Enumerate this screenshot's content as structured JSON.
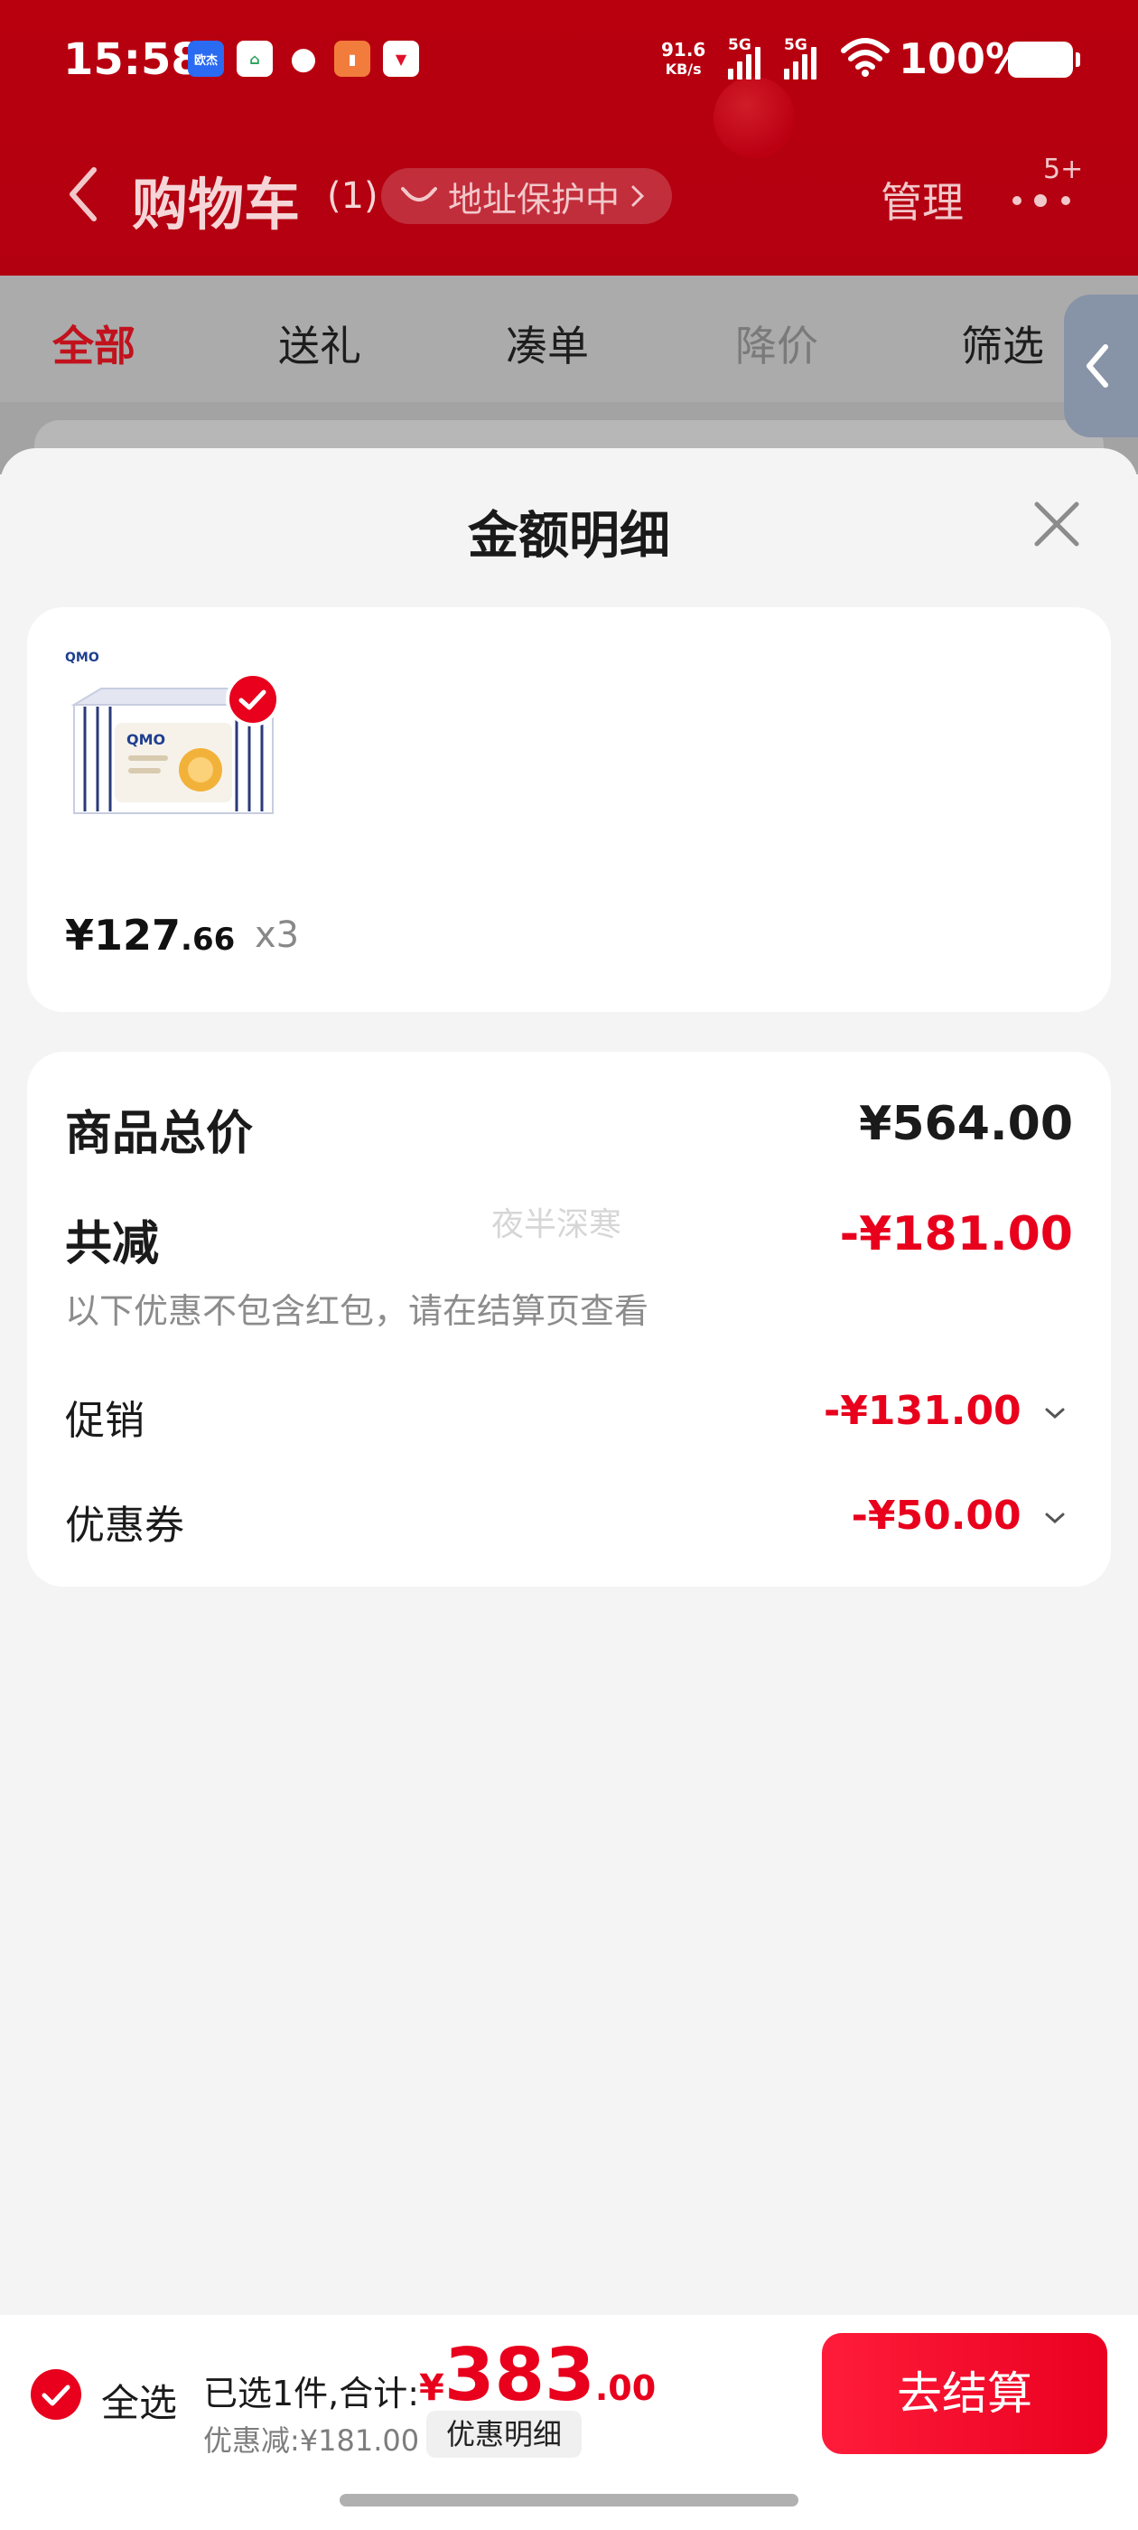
{
  "status_bar": {
    "time": "15:58",
    "notification_icons": [
      "欧杰",
      "app-house-icon",
      "qq-icon",
      "app-orange-icon",
      "app-red-icon"
    ],
    "net_speed_value": "91.6",
    "net_speed_unit": "KB/s",
    "signal1_label": "5G",
    "signal2_label": "5G",
    "battery": "100%"
  },
  "header": {
    "title": "购物车",
    "count": "(1)",
    "address_label": "地址保护中",
    "manage_label": "管理",
    "more_badge": "5+"
  },
  "tabs": [
    {
      "label": "全部"
    },
    {
      "label": "送礼"
    },
    {
      "label": "凑单"
    },
    {
      "label": "降价"
    },
    {
      "label": "筛选"
    }
  ],
  "sheet": {
    "title": "金额明细",
    "product": {
      "brand_text": "QMO",
      "price_main": "¥127",
      "price_decimal": ".66",
      "quantity": "x3"
    },
    "summary": {
      "goods_total_label": "商品总价",
      "goods_total_value": "¥564.00",
      "reduction_label": "共减",
      "reduction_value": "-¥181.00",
      "note": "以下优惠不包含红包，请在结算页查看",
      "watermark": "夜半深寒",
      "promo_label": "促销",
      "promo_value": "-¥131.00",
      "coupon_label": "优惠券",
      "coupon_value": "-¥50.00"
    }
  },
  "bottom_bar": {
    "select_all_label": "全选",
    "selected_text": "已选1件,合计:",
    "total_currency": "¥",
    "total_int": "383",
    "total_dec": ".00",
    "discount_text": "优惠减:¥181.00",
    "discount_detail_button": "优惠明细",
    "checkout_button": "去结算"
  },
  "colors": {
    "header_red": "#b8000f",
    "accent_red": "#e8001c",
    "tab_active": "#c2121d"
  }
}
